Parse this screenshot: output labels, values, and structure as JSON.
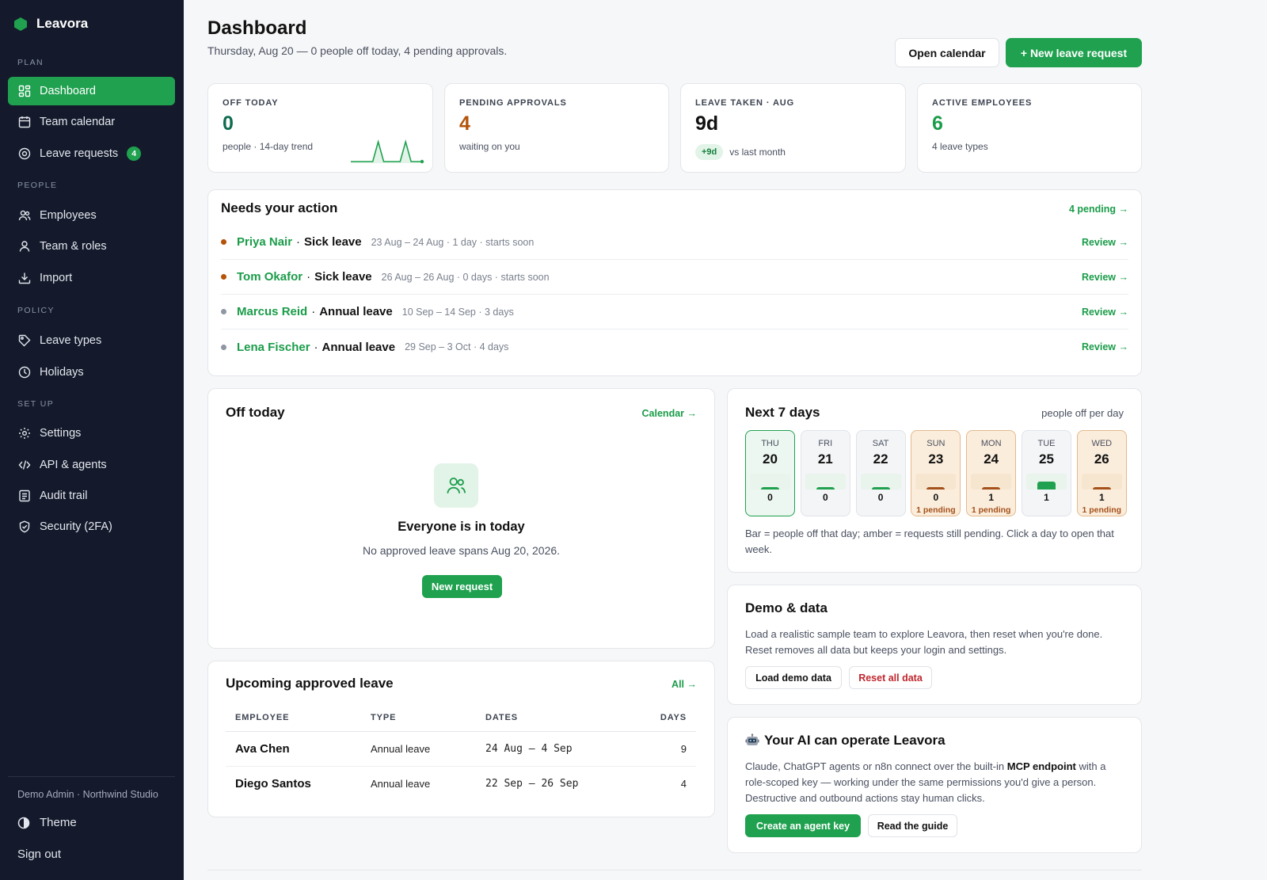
{
  "app": {
    "name": "Leavora",
    "brand_color": "#1fa14f"
  },
  "sidebar": {
    "sections": {
      "plan": "PLAN",
      "people": "PEOPLE",
      "policy": "POLICY",
      "setup": "SET UP"
    },
    "items": [
      {
        "label": "Dashboard",
        "icon": "dashboard-icon"
      },
      {
        "label": "Team calendar",
        "icon": "calendar-icon"
      },
      {
        "label": "Leave requests",
        "icon": "eye-icon",
        "badge": "4"
      },
      {
        "label": "Employees",
        "icon": "users-icon"
      },
      {
        "label": "Team & roles",
        "icon": "user-icon"
      },
      {
        "label": "Import",
        "icon": "download-icon"
      },
      {
        "label": "Leave types",
        "icon": "tag-icon"
      },
      {
        "label": "Holidays",
        "icon": "clock-icon"
      },
      {
        "label": "Settings",
        "icon": "gear-icon"
      },
      {
        "label": "API & agents",
        "icon": "code-icon"
      },
      {
        "label": "Audit trail",
        "icon": "list-icon"
      },
      {
        "label": "Security (2FA)",
        "icon": "shield-icon"
      }
    ],
    "user": "Demo Admin · Northwind Studio",
    "theme_label": "Theme",
    "signout_label": "Sign out"
  },
  "header": {
    "title": "Dashboard",
    "subtitle": "Thursday, Aug 20 — 0 people off today, 4 pending approvals.",
    "open_calendar": "Open calendar",
    "new_request": "+ New leave request"
  },
  "stats": [
    {
      "label": "OFF TODAY",
      "value": "0",
      "note": "people · 14-day trend",
      "color": "#0f6b4f"
    },
    {
      "label": "PENDING APPROVALS",
      "value": "4",
      "note": "waiting on you",
      "color": "#b45309"
    },
    {
      "label": "LEAVE TAKEN · AUG",
      "value": "9d",
      "delta": "+9d",
      "note": "vs last month",
      "color": "#111111"
    },
    {
      "label": "ACTIVE EMPLOYEES",
      "value": "6",
      "note": "4 leave types",
      "color": "#1a9c49"
    }
  ],
  "off_today_trend": [
    0,
    0,
    0,
    0,
    0,
    1,
    0,
    0,
    0,
    0,
    1,
    0,
    0,
    0
  ],
  "needs_action": {
    "title": "Needs your action",
    "link": "4 pending →",
    "review_label": "Review →",
    "items": [
      {
        "name": "Priya Nair",
        "type": "Sick leave",
        "meta": "23 Aug – 24 Aug · 1 day · starts soon",
        "dot": "#b45309"
      },
      {
        "name": "Tom Okafor",
        "type": "Sick leave",
        "meta": "26 Aug – 26 Aug · 0 days · starts soon",
        "dot": "#b45309"
      },
      {
        "name": "Marcus Reid",
        "type": "Annual leave",
        "meta": "10 Sep – 14 Sep · 3 days",
        "dot": "#9096a2"
      },
      {
        "name": "Lena Fischer",
        "type": "Annual leave",
        "meta": "29 Sep – 3 Oct · 4 days",
        "dot": "#9096a2"
      }
    ]
  },
  "off_today": {
    "title": "Off today",
    "link": "Calendar →",
    "empty_title": "Everyone is in today",
    "empty_text": "No approved leave spans Aug 20, 2026.",
    "button": "New request"
  },
  "upcoming": {
    "title": "Upcoming approved leave",
    "link": "All →",
    "columns": [
      "EMPLOYEE",
      "TYPE",
      "DATES",
      "DAYS"
    ],
    "rows": [
      {
        "employee": "Ava Chen",
        "type": "Annual leave",
        "dates": "24 Aug – 4 Sep",
        "days": "9"
      },
      {
        "employee": "Diego Santos",
        "type": "Annual leave",
        "dates": "22 Sep – 26 Sep",
        "days": "4"
      }
    ]
  },
  "next7": {
    "title": "Next 7 days",
    "subtitle": "people off per day",
    "days": [
      {
        "name": "THU",
        "num": "20",
        "count": "0",
        "pending": "",
        "fill": 0.15,
        "state": "today"
      },
      {
        "name": "FRI",
        "num": "21",
        "count": "0",
        "pending": "",
        "fill": 0.15,
        "state": "normal"
      },
      {
        "name": "SAT",
        "num": "22",
        "count": "0",
        "pending": "",
        "fill": 0.15,
        "state": "normal"
      },
      {
        "name": "SUN",
        "num": "23",
        "count": "0",
        "pending": "1 pending",
        "fill": 0.15,
        "state": "pending"
      },
      {
        "name": "MON",
        "num": "24",
        "count": "1",
        "pending": "1 pending",
        "fill": 0.15,
        "state": "pending"
      },
      {
        "name": "TUE",
        "num": "25",
        "count": "1",
        "pending": "",
        "fill": 0.5,
        "state": "normal"
      },
      {
        "name": "WED",
        "num": "26",
        "count": "1",
        "pending": "1 pending",
        "fill": 0.15,
        "state": "pending"
      }
    ],
    "caption": "Bar = people off that day; amber = requests still pending. Click a day to open that week."
  },
  "demo": {
    "title": "Demo & data",
    "text": "Load a realistic sample team to explore Leavora, then reset when you're done. Reset removes all data but keeps your login and settings.",
    "load": "Load demo data",
    "reset": "Reset all data"
  },
  "ai": {
    "title": "Your AI can operate Leavora",
    "icon": "robot-icon",
    "text_a": "Claude, ChatGPT agents or n8n connect over the built-in ",
    "text_b": "MCP endpoint",
    "text_c": " with a role-scoped key — working under the same permissions you'd give a person. Destructive and outbound actions stay human clicks.",
    "create": "Create an agent key",
    "guide": "Read the guide"
  }
}
